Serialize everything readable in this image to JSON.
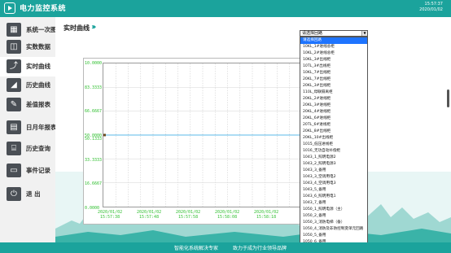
{
  "app": {
    "title": "电力监控系统",
    "time": "15:57:37",
    "date": "2020/01/02"
  },
  "sidebar": {
    "items": [
      {
        "label": "系统一次图",
        "icon": "diagram-icon",
        "glyph": "▦"
      },
      {
        "label": "实数数据",
        "icon": "data-icon",
        "glyph": "◫"
      },
      {
        "label": "实时曲线",
        "icon": "realtime-curve-icon",
        "glyph": "⤴",
        "active": true
      },
      {
        "label": "历史曲线",
        "icon": "history-curve-icon",
        "glyph": "◢"
      },
      {
        "label": "差值报表",
        "icon": "report-icon",
        "glyph": "✎"
      },
      {
        "label": "日月年报表",
        "icon": "calendar-report-icon",
        "glyph": "▤"
      },
      {
        "label": "历史查询",
        "icon": "history-query-icon",
        "glyph": "⌸"
      },
      {
        "label": "事件记录",
        "icon": "event-log-icon",
        "glyph": "▭"
      },
      {
        "label": "退 出",
        "icon": "power-icon",
        "glyph": "⏻"
      }
    ]
  },
  "main": {
    "title": "实时曲线"
  },
  "chart_data": {
    "type": "line",
    "yticks": [
      "10.0000",
      "83.3333",
      "66.6667",
      "50.0000",
      "33.3333",
      "16.6667",
      "0.0000"
    ],
    "xticks": [
      {
        "date": "2020/01/02",
        "time": "15:57:38"
      },
      {
        "date": "2020/01/02",
        "time": "15:57:48"
      },
      {
        "date": "2020/01/02",
        "time": "15:57:58"
      },
      {
        "date": "2020/01/02",
        "time": "15:58:08"
      },
      {
        "date": "2020/01/02",
        "time": "15:58:18"
      }
    ],
    "series": [
      {
        "values": [
          50,
          50,
          50,
          50,
          50
        ]
      }
    ],
    "marker_label": "50.1333",
    "grid": true
  },
  "dropdown": {
    "selected": "请选择回路",
    "options": [
      "请选择回路",
      "10KL_1#进线总柜",
      "10KL_2#进线总柜",
      "10KL_3#出线柜",
      "10TL_3#出线柜",
      "10KL_7#出线柜",
      "20KL_7#出线柜",
      "20KL_3#出线柜",
      "110L_母联隔离柜",
      "20KL_2#进线柜",
      "20KL_3#进线柜",
      "20KL_4#进线柜",
      "20KL_6#进线柜",
      "20TL_6#进线柜",
      "20KL_8#出线柜",
      "20KL_10#出线柜",
      "1015_低压进线柜",
      "1016_无功自动补偿柜",
      "1043_1_照明电源2",
      "1043_2_照明电源3",
      "1043_3_备用",
      "1043_3_空调用电2",
      "1043_4_空调用电3",
      "1043_5_备用",
      "1043_6_照明用电1",
      "1043_7_备用",
      "1050_1_照明电源（主）",
      "1050_2_备用",
      "1050_3_消防电梯（备）",
      "1050_4_消防及非防控制变单元回路",
      "1050_5_备用",
      "1050_6_备用",
      "1050_7_照明电源（主）",
      "1050_8_备用"
    ]
  },
  "footer": {
    "left": "智能化系统解决专家",
    "right": "致力于成为行业领导品牌"
  },
  "colors": {
    "accent": "#1ba39c",
    "selected": "#1e74ff",
    "tick": "#2fbf2f"
  }
}
